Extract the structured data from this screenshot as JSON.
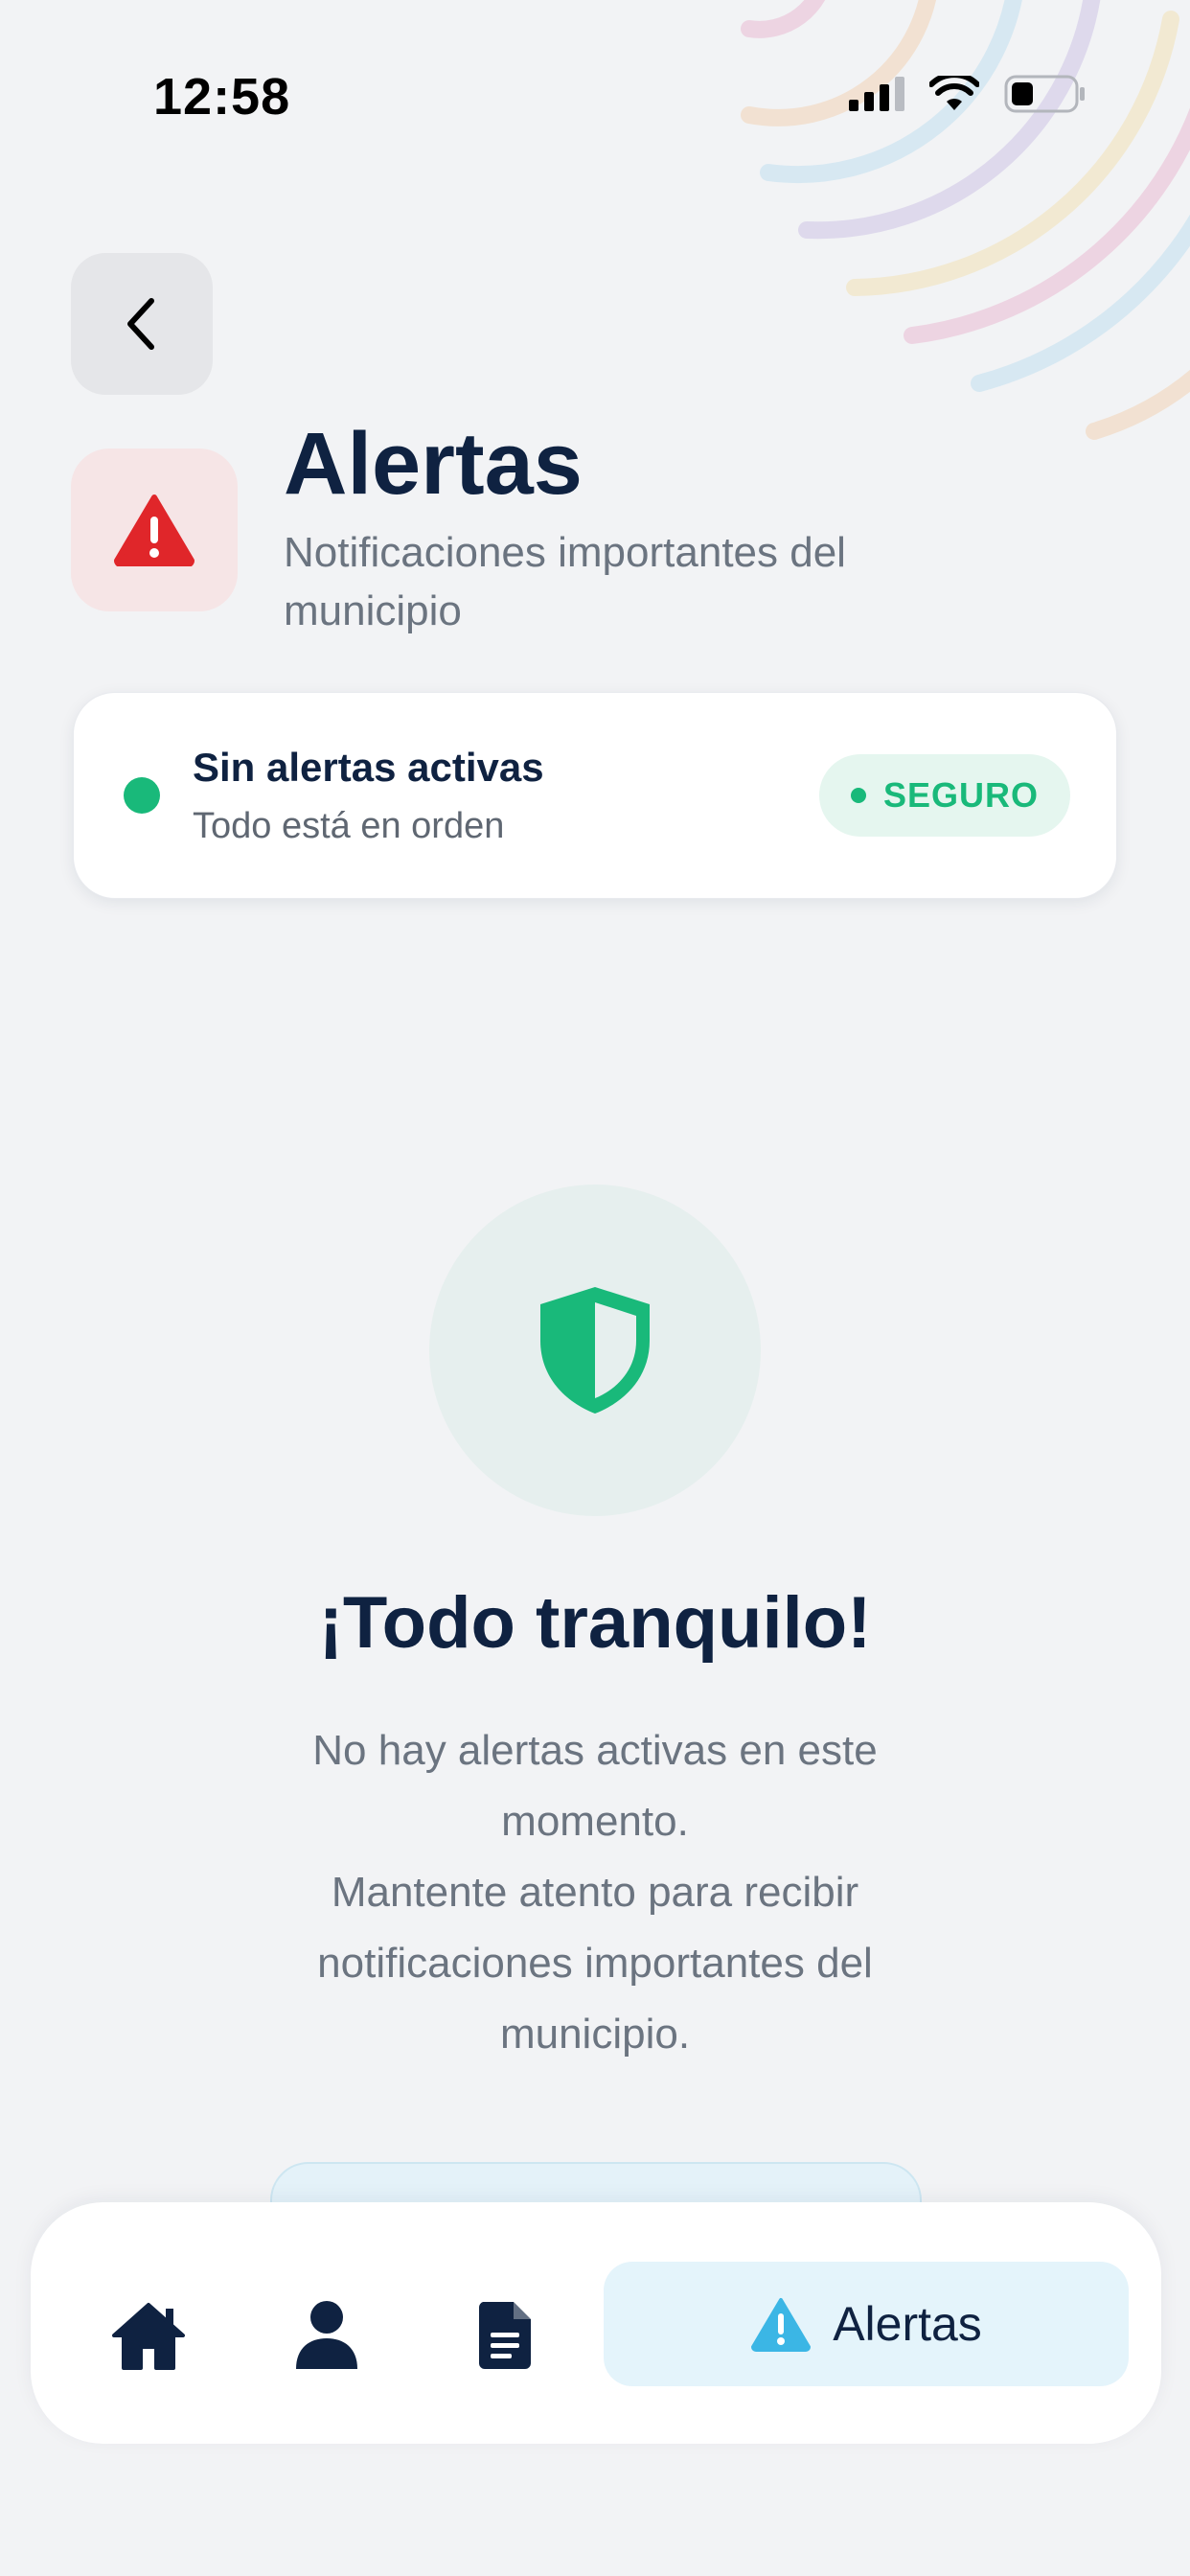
{
  "status_bar": {
    "time": "12:58"
  },
  "header": {
    "title": "Alertas",
    "subtitle": "Notificaciones importantes del municipio"
  },
  "status_card": {
    "title": "Sin alertas activas",
    "subtitle": "Todo está en orden",
    "badge": "SEGURO"
  },
  "empty_state": {
    "title": "¡Todo tranquilo!",
    "line1": "No hay alertas activas en este momento.",
    "line2": "Mantente atento para recibir notificaciones importantes del municipio."
  },
  "bottom_nav": {
    "items": [
      {
        "icon": "home-icon"
      },
      {
        "icon": "user-icon"
      },
      {
        "icon": "document-icon"
      },
      {
        "icon": "warning-icon",
        "label": "Alertas",
        "active": true
      }
    ]
  },
  "colors": {
    "background": "#f2f3f5",
    "navy": "#0f2241",
    "success": "#19b97a",
    "danger": "#e0262a",
    "alert_blue": "#3bb6e5"
  }
}
